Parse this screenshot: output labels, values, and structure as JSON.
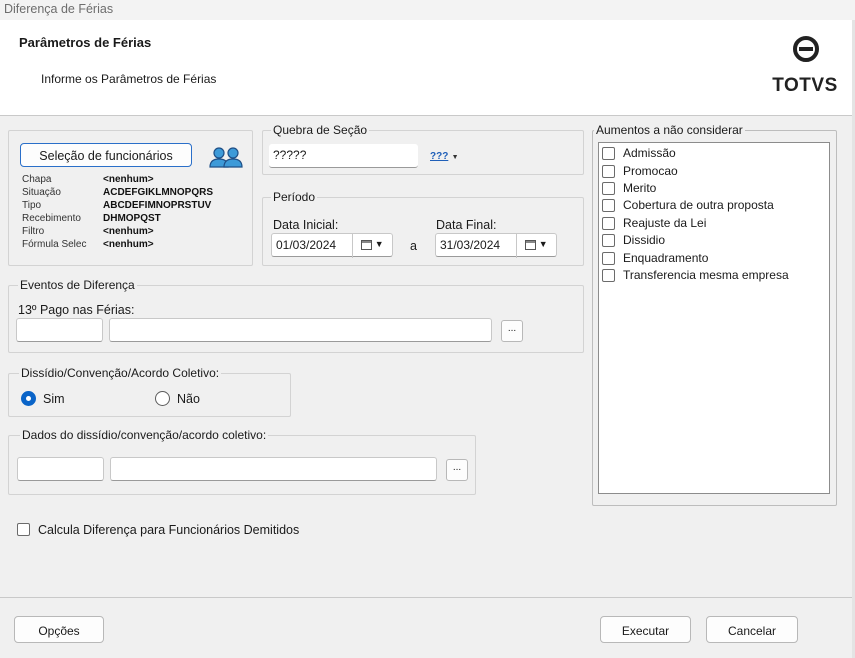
{
  "window": {
    "title": "Diferença de Férias"
  },
  "header": {
    "title": "Parâmetros de Férias",
    "subtitle": "Informe os Parâmetros de Férias",
    "logo_text": "TOTVS"
  },
  "selection": {
    "button_label": "Seleção de funcionários",
    "icon": "users-icon",
    "rows": [
      {
        "label": "Chapa",
        "value": "<nenhum>"
      },
      {
        "label": "Situação",
        "value": "ACDEFGIKLMNOPQRS"
      },
      {
        "label": "Tipo",
        "value": "ABCDEFIMNOPRSTUV"
      },
      {
        "label": "Recebimento",
        "value": "DHMOPQST"
      },
      {
        "label": "Filtro",
        "value": "<nenhum>"
      },
      {
        "label": "Fórmula Selec",
        "value": "<nenhum>"
      }
    ]
  },
  "quebra": {
    "legend": "Quebra de Seção",
    "value": "?????",
    "picker_label": "???"
  },
  "periodo": {
    "legend": "Período",
    "start_label": "Data Inicial:",
    "start_value": "01/03/2024",
    "sep": "a",
    "end_label": "Data Final:",
    "end_value": "31/03/2024"
  },
  "eventos": {
    "legend": "Eventos de Diferença",
    "field_label": "13º Pago nas Férias:",
    "code": "",
    "description": "",
    "browse_label": "..."
  },
  "dissidio": {
    "legend": "Dissídio/Convenção/Acordo Coletivo:",
    "options": [
      {
        "label": "Sim",
        "selected": true
      },
      {
        "label": "Não",
        "selected": false
      }
    ]
  },
  "dados_dissidio": {
    "legend": "Dados do dissídio/convenção/acordo coletivo:",
    "code": "",
    "description": "",
    "browse_label": "..."
  },
  "demitidos": {
    "label": "Calcula Diferença para Funcionários Demitidos",
    "checked": false
  },
  "aumentos": {
    "legend": "Aumentos a não considerar",
    "items": [
      "Admissão",
      "Promocao",
      "Merito",
      "Cobertura de outra proposta",
      "Reajuste da Lei",
      "Dissidio",
      "Enquadramento",
      "Transferencia mesma empresa"
    ]
  },
  "footer": {
    "options_label": "Opções",
    "execute_label": "Executar",
    "cancel_label": "Cancelar"
  },
  "colors": {
    "accent": "#0a64c8",
    "selection_button_border": "#2a6fc9"
  }
}
